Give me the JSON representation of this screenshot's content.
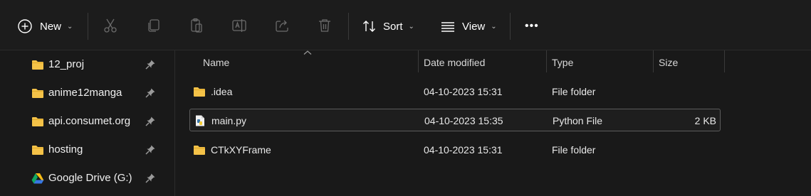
{
  "toolbar": {
    "new_label": "New",
    "sort_label": "Sort",
    "view_label": "View",
    "more_label": "•••",
    "icons": [
      "plus-circle-icon",
      "cut-icon",
      "copy-icon",
      "paste-icon",
      "rename-icon",
      "share-icon",
      "delete-icon",
      "sort-icon",
      "view-icon"
    ]
  },
  "nav": {
    "items": [
      {
        "label": "12_proj",
        "icon": "folder-icon"
      },
      {
        "label": "anime12manga",
        "icon": "folder-icon"
      },
      {
        "label": "api.consumet.org",
        "icon": "folder-icon"
      },
      {
        "label": "hosting",
        "icon": "folder-icon"
      },
      {
        "label": "Google Drive (G:)",
        "icon": "google-drive-icon"
      }
    ]
  },
  "table": {
    "columns": [
      "Name",
      "Date modified",
      "Type",
      "Size"
    ],
    "rows": [
      {
        "name": ".idea",
        "date": "04-10-2023 15:31",
        "type": "File folder",
        "size": "",
        "icon": "folder-icon"
      },
      {
        "name": "main.py",
        "date": "04-10-2023 15:35",
        "type": "Python File",
        "size": "2 KB",
        "icon": "python-file-icon",
        "selected": true
      },
      {
        "name": "CTkXYFrame",
        "date": "04-10-2023 15:31",
        "type": "File folder",
        "size": "",
        "icon": "folder-icon"
      }
    ]
  },
  "colors": {
    "background": "#191919",
    "folder": "#f4c248",
    "selection_border": "#5c5c5c",
    "text": "#e6e6e6"
  }
}
